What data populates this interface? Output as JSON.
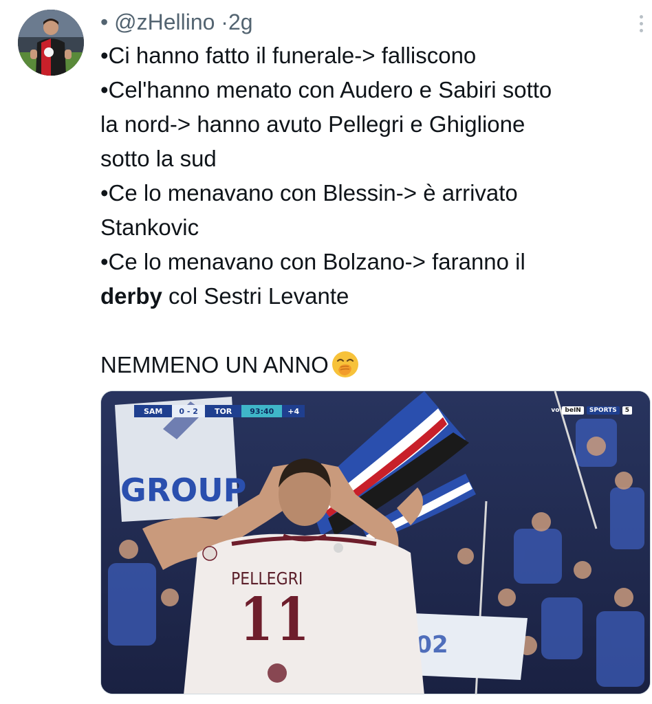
{
  "author": {
    "bullet": "•",
    "handle": "@zHellino",
    "separator": "·",
    "time": "2g",
    "avatar_icon": "profile-avatar"
  },
  "tweet": {
    "lines": [
      "•Ci hanno fatto il funerale-> falliscono",
      "•Cel'hanno menato con Audero e Sabiri sotto",
      "la nord-> hanno avuto Pellegri e Ghiglione",
      "sotto la sud",
      "•Ce lo menavano con Blessin-> è arrivato",
      "Stankovic",
      "•Ce lo menavano con Bolzano-> faranno il"
    ],
    "last_line_bold": "derby",
    "last_line_rest": " col Sestri Levante",
    "closing": "NEMMENO UN ANNO",
    "closing_emoji": "face-with-hand-over-mouth-emoji"
  },
  "media": {
    "scorebug": {
      "home": "SAM",
      "score": "0 - 2",
      "away": "TOR",
      "clock": "93:40",
      "added": "+4"
    },
    "broadcaster": {
      "prefix": "vo",
      "brand": "beIN",
      "channel": "SPORTS",
      "number": "5"
    },
    "player_name": "PELLEGRI",
    "player_number": "11",
    "banner_text": "GROUP"
  },
  "colors": {
    "text": "#0f1419",
    "secondary_text": "#536471",
    "shirt_trim": "#6e1e2c",
    "crowd_blue": "#2a4fae"
  }
}
